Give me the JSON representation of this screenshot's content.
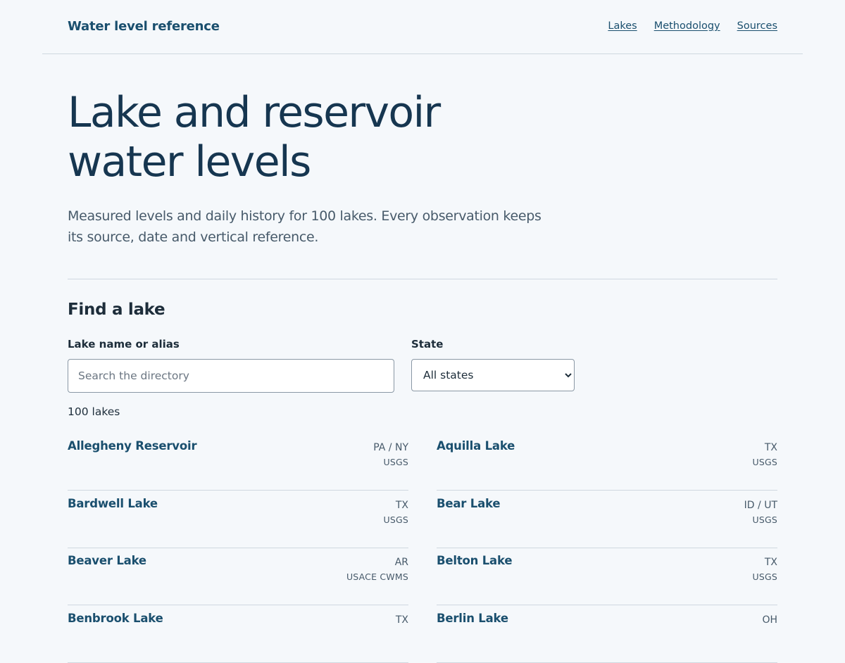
{
  "header": {
    "brand": "Water level reference",
    "nav": [
      "Lakes",
      "Methodology",
      "Sources"
    ]
  },
  "hero": {
    "title": "Lake and reservoir water levels",
    "subtitle": "Measured levels and daily history for 100 lakes. Every observation keeps its source, date and vertical reference."
  },
  "finder": {
    "title": "Find a lake",
    "search_label": "Lake name or alias",
    "search_placeholder": "Search the directory",
    "search_value": "",
    "state_label": "State",
    "state_selected": "All states",
    "count": "100 lakes"
  },
  "lakes": [
    {
      "name": "Allegheny Reservoir",
      "state": "PA / NY",
      "source": "USGS"
    },
    {
      "name": "Aquilla Lake",
      "state": "TX",
      "source": "USGS"
    },
    {
      "name": "Bardwell Lake",
      "state": "TX",
      "source": "USGS"
    },
    {
      "name": "Bear Lake",
      "state": "ID / UT",
      "source": "USGS"
    },
    {
      "name": "Beaver Lake",
      "state": "AR",
      "source": "USACE CWMS"
    },
    {
      "name": "Belton Lake",
      "state": "TX",
      "source": "USGS"
    },
    {
      "name": "Benbrook Lake",
      "state": "TX",
      "source": ""
    },
    {
      "name": "Berlin Lake",
      "state": "OH",
      "source": ""
    }
  ]
}
